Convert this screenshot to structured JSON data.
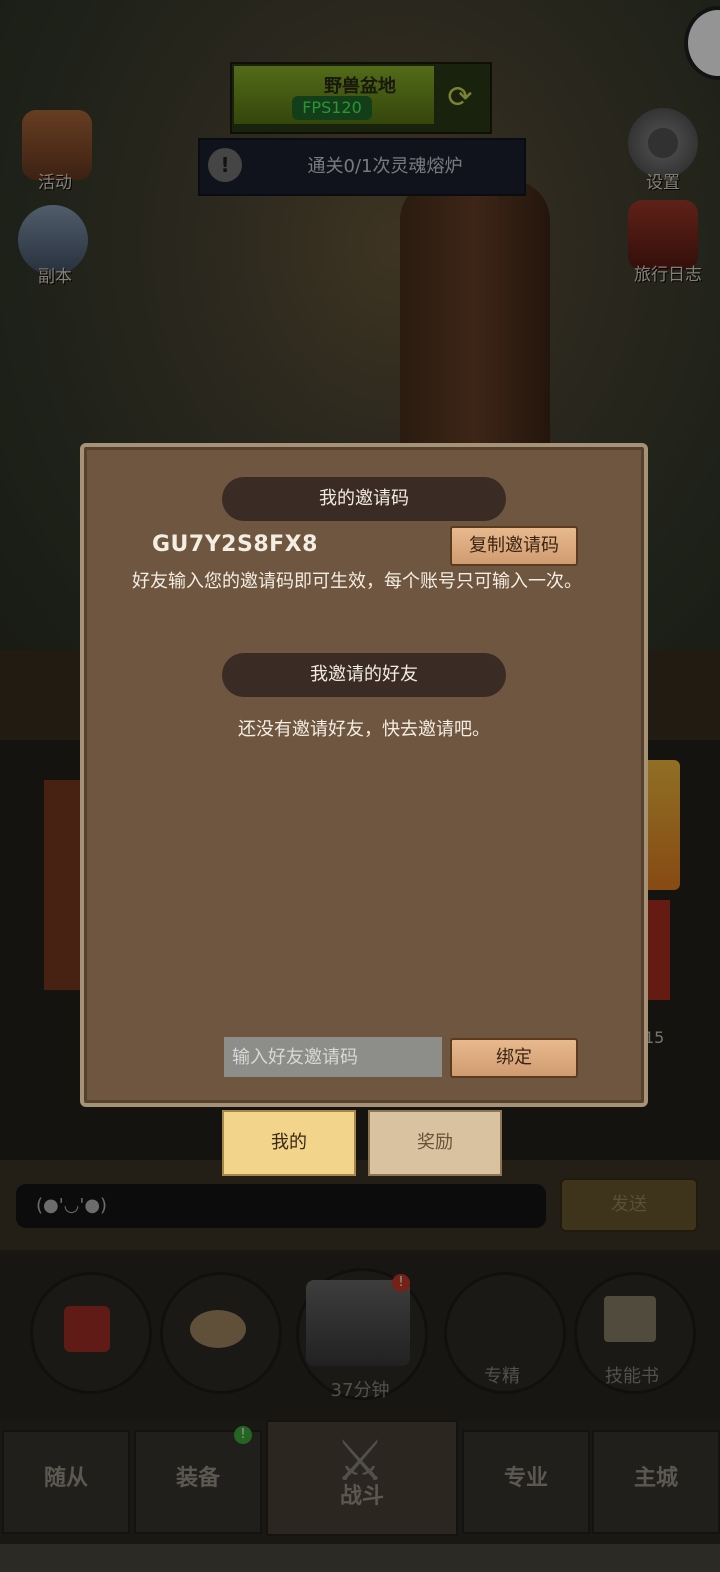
{
  "hud": {
    "stage_name": "野兽盆地",
    "fps": "FPS120",
    "quest": "通关0/1次灵魂熔炉"
  },
  "side": {
    "activity": "活动",
    "dungeon": "副本",
    "settings": "设置",
    "journal": "旅行日志"
  },
  "dialog": {
    "my_code_title": "我的邀请码",
    "my_code": "GU7Y2S8FX8",
    "copy_button": "复制邀请码",
    "description": "好友输入您的邀请码即可生效，每个账号只可输入一次。",
    "invited_title": "我邀请的好友",
    "empty_text": "还没有邀请好友，快去邀请吧。",
    "input_placeholder": "输入好友邀请码",
    "bind_button": "绑定"
  },
  "tabs": {
    "mine": "我的",
    "reward": "奖励"
  },
  "chat": {
    "emoji": "(●'◡'●)",
    "send": "发送"
  },
  "actions": {
    "chest_timer": "37分钟",
    "specialization": "专精",
    "skill_book": "技能书",
    "slot_count": "15"
  },
  "nav": {
    "followers": "随从",
    "equipment": "装备",
    "battle": "战斗",
    "profession": "专业",
    "main_city": "主城"
  },
  "colors": {
    "dialog_bg": "#6e5640",
    "banner_bg": "#3a2c24",
    "wood_button": "#e0b185",
    "tab_active": "#f2d48a",
    "tab_inactive": "#d9c2a0"
  }
}
